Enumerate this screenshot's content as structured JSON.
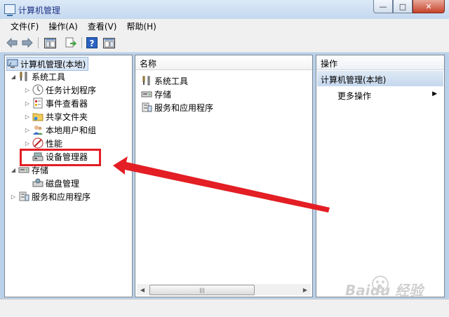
{
  "window": {
    "title": "计算机管理",
    "controls": {
      "minimize": "—",
      "maximize": "□",
      "close": "✕"
    }
  },
  "menu": [
    "文件(F)",
    "操作(A)",
    "查看(V)",
    "帮助(H)"
  ],
  "toolbar": {
    "buttons": [
      "back-icon",
      "forward-icon",
      "show-tree-icon",
      "export-icon",
      "help-icon",
      "show-action-pane-icon"
    ]
  },
  "tree": {
    "root": "计算机管理(本地)",
    "system_tools": "系统工具",
    "task_scheduler": "任务计划程序",
    "event_viewer": "事件查看器",
    "shared_folders": "共享文件夹",
    "local_users": "本地用户和组",
    "performance": "性能",
    "device_manager": "设备管理器",
    "storage": "存储",
    "disk_management": "磁盘管理",
    "services": "服务和应用程序"
  },
  "center": {
    "column_name": "名称",
    "items": [
      "系统工具",
      "存储",
      "服务和应用程序"
    ]
  },
  "actions": {
    "header": "操作",
    "selected": "计算机管理(本地)",
    "more": "更多操作"
  },
  "colors": {
    "annotation": "#e31e24",
    "selected": "#c5d8ee",
    "frame": "#b9d1ea"
  },
  "watermark": "Baidu 经验"
}
